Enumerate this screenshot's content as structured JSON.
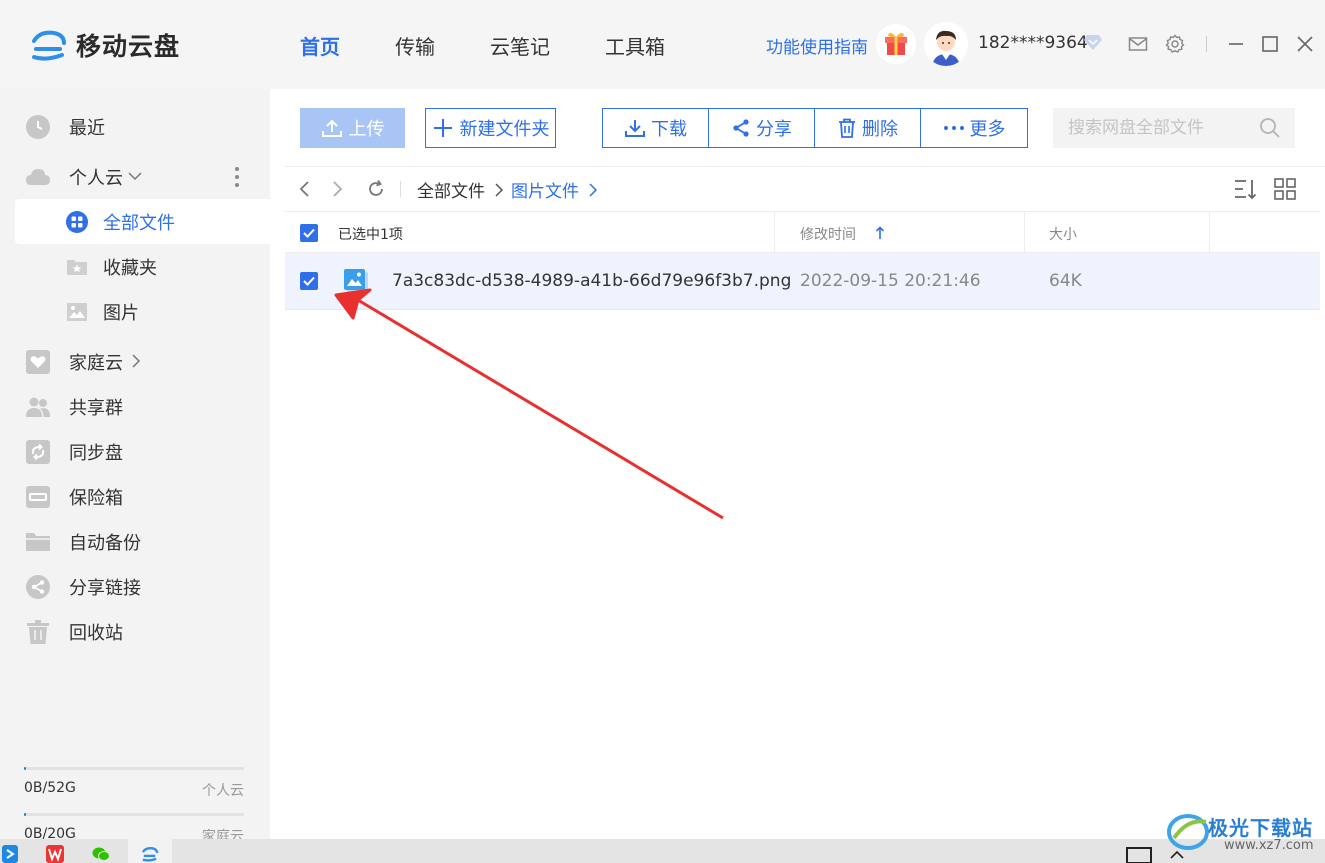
{
  "app": {
    "name": "移动云盘"
  },
  "nav": [
    "首页",
    "传输",
    "云笔记",
    "工具箱"
  ],
  "header": {
    "guide": "功能使用指南",
    "phone": "182****9364"
  },
  "sidebar": {
    "recent": "最近",
    "personal_cloud": "个人云",
    "all_files": "全部文件",
    "favorites": "收藏夹",
    "pictures": "图片",
    "family_cloud": "家庭云",
    "share_group": "共享群",
    "sync_disk": "同步盘",
    "safe_box": "保险箱",
    "auto_backup": "自动备份",
    "share_links": "分享链接",
    "recycle_bin": "回收站"
  },
  "storage": [
    {
      "used": "0B/52G",
      "name": "个人云",
      "fraction": 0.005
    },
    {
      "used": "0B/20G",
      "name": "家庭云",
      "fraction": 0.005
    }
  ],
  "toolbar": {
    "upload": "上传",
    "new_folder": "新建文件夹",
    "download": "下载",
    "share": "分享",
    "delete": "删除",
    "more": "更多",
    "search_placeholder": "搜索网盘全部文件"
  },
  "breadcrumb": {
    "root": "全部文件",
    "current": "图片文件"
  },
  "table": {
    "selected_label": "已选中1项",
    "col_modified": "修改时间",
    "col_size": "大小",
    "rows": [
      {
        "name": "7a3c83dc-d538-4989-a41b-66d79e96f3b7.png",
        "modified": "2022-09-15 20:21:46",
        "size": "64K",
        "checked": true
      }
    ]
  },
  "watermark": {
    "text": "极光下载站",
    "url": "www.xz7.com"
  },
  "colors": {
    "accent": "#2f6fe8",
    "annotation_arrow": "#e8312f"
  }
}
